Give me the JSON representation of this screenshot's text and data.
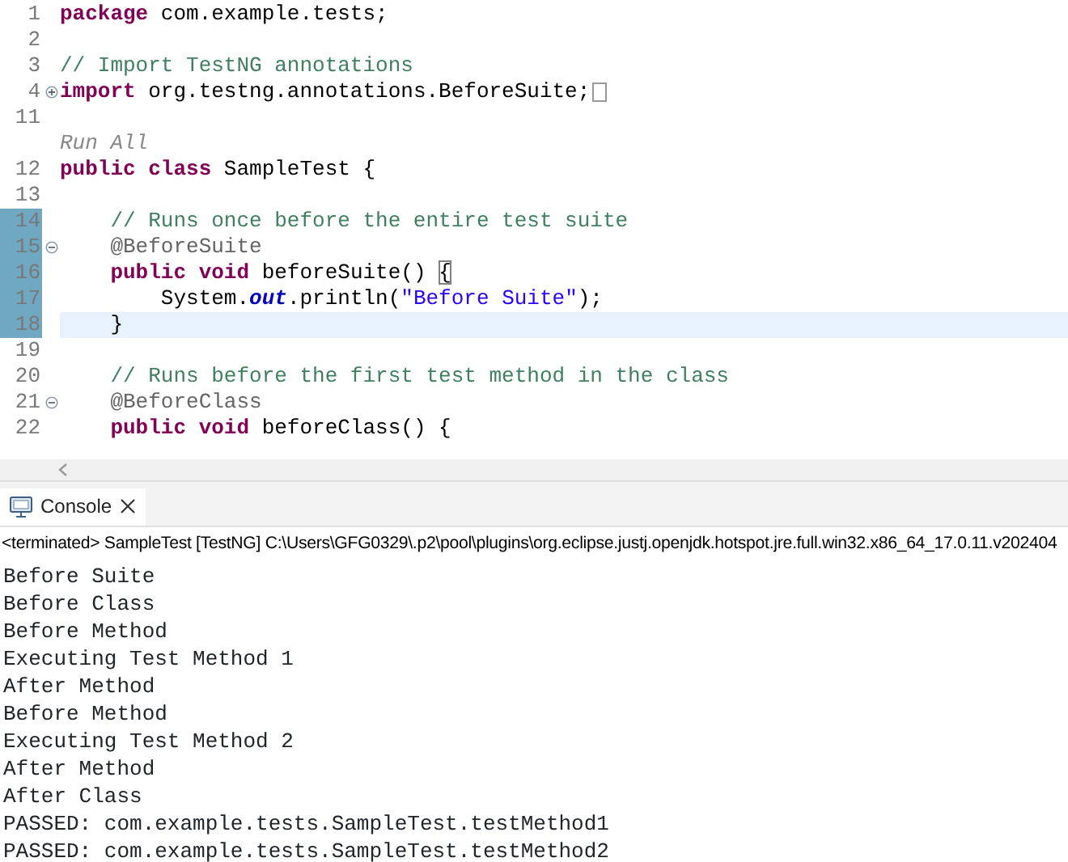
{
  "editor": {
    "lines": [
      {
        "kind": "code",
        "number": "1",
        "changed": false,
        "current": false,
        "tokens": [
          {
            "kind": "keyword",
            "text": "package"
          },
          {
            "kind": "plain",
            "text": " com.example.tests;"
          }
        ]
      },
      {
        "kind": "code",
        "number": "2",
        "changed": false,
        "current": false
      },
      {
        "kind": "code",
        "number": "3",
        "changed": false,
        "current": false,
        "tokens": [
          {
            "kind": "comment",
            "text": "// Import TestNG annotations"
          }
        ]
      },
      {
        "kind": "code",
        "number": "4",
        "fold_expanded": false,
        "folded_more": true,
        "changed": false,
        "current": false,
        "tokens": [
          {
            "kind": "keyword",
            "text": "import"
          },
          {
            "kind": "plain",
            "text": " org.testng.annotations.BeforeSuite;"
          }
        ]
      },
      {
        "kind": "code",
        "number": "11",
        "changed": false,
        "current": false
      },
      {
        "kind": "codelens",
        "text": "Run All"
      },
      {
        "kind": "code",
        "number": "12",
        "changed": false,
        "current": false,
        "tokens": [
          {
            "kind": "keyword",
            "text": "public class"
          },
          {
            "kind": "plain",
            "text": " SampleTest {"
          }
        ]
      },
      {
        "kind": "code",
        "number": "13",
        "changed": false,
        "current": false
      },
      {
        "kind": "code",
        "number": "14",
        "changed": true,
        "current": false,
        "tokens": [
          {
            "kind": "comment",
            "text": "    // Runs once before the entire test suite"
          }
        ]
      },
      {
        "kind": "code",
        "number": "15",
        "fold_expanded": true,
        "changed": true,
        "current": false,
        "tokens": [
          {
            "kind": "annotation",
            "text": "    @BeforeSuite"
          }
        ]
      },
      {
        "kind": "code",
        "number": "16",
        "changed": true,
        "current": false,
        "tokens": [
          {
            "kind": "keyword",
            "text": "    public void"
          },
          {
            "kind": "plain",
            "text": " beforeSuite() "
          },
          {
            "kind": "bracket-match",
            "text": "{"
          }
        ]
      },
      {
        "kind": "code",
        "number": "17",
        "changed": true,
        "current": false,
        "tokens": [
          {
            "kind": "plain",
            "text": "        System."
          },
          {
            "kind": "field",
            "text": "out"
          },
          {
            "kind": "plain",
            "text": ".println("
          },
          {
            "kind": "string",
            "text": "\"Before Suite\""
          },
          {
            "kind": "plain",
            "text": ");"
          }
        ]
      },
      {
        "kind": "code",
        "number": "18",
        "changed": true,
        "current": true,
        "tokens": [
          {
            "kind": "plain",
            "text": "    }"
          }
        ]
      },
      {
        "kind": "code",
        "number": "19",
        "changed": false,
        "current": false
      },
      {
        "kind": "code",
        "number": "20",
        "changed": false,
        "current": false,
        "tokens": [
          {
            "kind": "comment",
            "text": "    // Runs before the first test method in the class"
          }
        ]
      },
      {
        "kind": "code",
        "number": "21",
        "fold_expanded": true,
        "changed": false,
        "current": false,
        "tokens": [
          {
            "kind": "annotation",
            "text": "    @BeforeClass"
          }
        ]
      },
      {
        "kind": "code",
        "number": "22",
        "changed": false,
        "current": false,
        "tokens": [
          {
            "kind": "keyword",
            "text": "    public void"
          },
          {
            "kind": "plain",
            "text": " beforeClass() {"
          }
        ]
      }
    ]
  },
  "console": {
    "tab": {
      "label": "Console",
      "selected": true
    },
    "status": "<terminated> SampleTest [TestNG] C:\\Users\\GFG0329\\.p2\\pool\\plugins\\org.eclipse.justj.openjdk.hotspot.jre.full.win32.x86_64_17.0.11.v202404",
    "output": [
      "Before Suite",
      "Before Class",
      "Before Method",
      "Executing Test Method 1",
      "After Method",
      "Before Method",
      "Executing Test Method 2",
      "After Method",
      "After Class",
      "PASSED: com.example.tests.SampleTest.testMethod1",
      "PASSED: com.example.tests.SampleTest.testMethod2"
    ]
  }
}
